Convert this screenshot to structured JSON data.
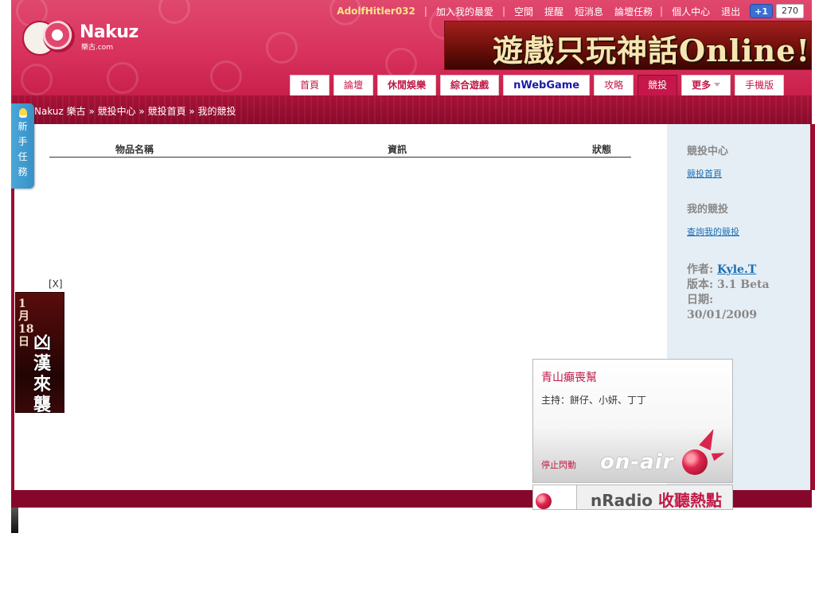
{
  "header": {
    "logo": {
      "brand": "Nakuz",
      "domain": "樂古.com"
    },
    "top_links": {
      "username": "AdolfHitler032",
      "separator": "|",
      "favorite": "加入我的最愛",
      "links": [
        "空間",
        "提醒",
        "短消息",
        "論壇任務"
      ],
      "personal_center": "個人中心",
      "logout": "退出",
      "plus_one": "+1",
      "plus_one_count": "270"
    },
    "banner_text": "遊戲只玩神話Online!",
    "main_nav": [
      {
        "label": "首頁",
        "style": "normal"
      },
      {
        "label": "論壇",
        "style": "normal"
      },
      {
        "label": "休閒娛樂",
        "style": "bold"
      },
      {
        "label": "綜合遊戲",
        "style": "bold"
      },
      {
        "label": "nWebGame",
        "style": "blue"
      },
      {
        "label": "攻略",
        "style": "normal"
      },
      {
        "label": "競投",
        "style": "active"
      },
      {
        "label": "更多",
        "style": "bold"
      },
      {
        "label": "手機版",
        "style": "normal"
      }
    ]
  },
  "breadcrumb": "Nakuz 樂古 » 競投中心 » 競投首頁 » 我的競投",
  "newbie_tab": [
    "新",
    "手",
    "任",
    "務"
  ],
  "table": {
    "headers": [
      "物品名稱",
      "資訊",
      "狀態"
    ]
  },
  "sidebar": {
    "section1_title": "競投中心",
    "section1_link": "競投首頁",
    "section2_title": "我的競投",
    "section2_link": "查詢我的競投",
    "author_label": "作者:",
    "author": "Kyle.T",
    "version": "版本: 3.1 Beta",
    "date_label": "日期:",
    "date": "30/01/2009"
  },
  "side_ad": {
    "close": "[X]",
    "date_text": "1月18日",
    "big_text": "凶漢來襲"
  },
  "onair": {
    "title": "青山癲喪幫",
    "host": "主持：餅仔、小妍、丁丁",
    "stop": "停止閃動",
    "word": "on-air"
  },
  "nradio": {
    "brand": "nRadio",
    "label": "收聽熱點"
  },
  "colors": {
    "header": "#d7305b",
    "crumb_bar": "#9b0e31",
    "accent": "#c01a47",
    "link": "#1a6db3",
    "sidebar_bg": "#e6eef5"
  }
}
